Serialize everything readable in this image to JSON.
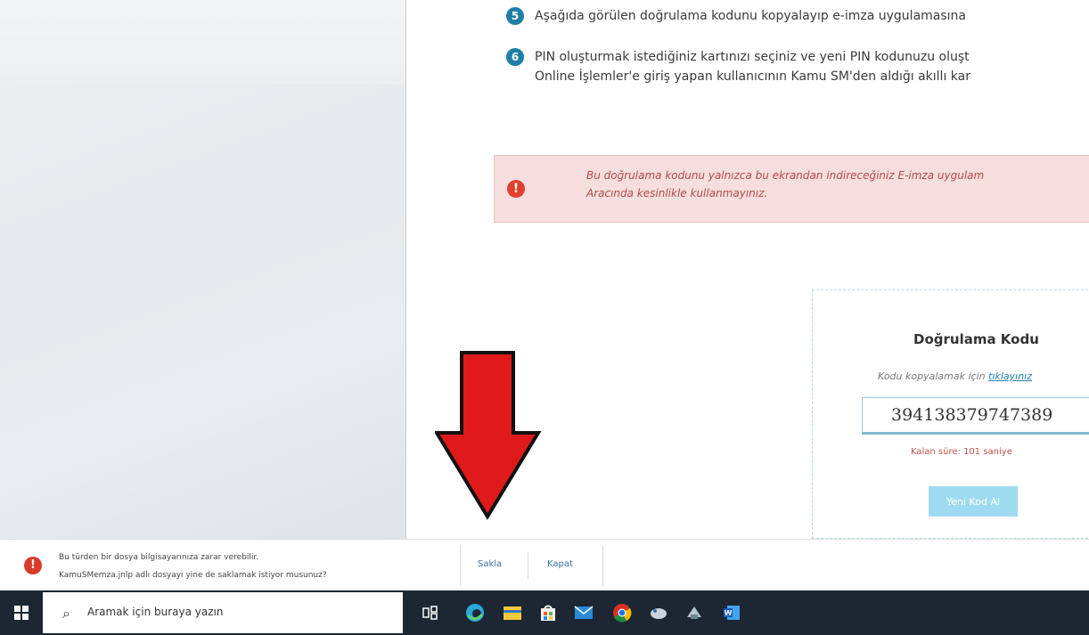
{
  "steps": [
    {
      "num": "5",
      "text": "Aşağıda görülen doğrulama kodunu kopyalayıp e-imza uygulamasına"
    },
    {
      "num": "6",
      "text": "PIN oluşturmak istediğiniz kartınızı seçiniz ve yeni PIN kodunuzu oluşt",
      "text2": "Online İşlemler'e giriş yapan kullanıcının Kamu SM'den aldığı akıllı kar"
    }
  ],
  "alert": {
    "icon": "!",
    "line1": "Bu doğrulama kodunu yalnızca bu ekrandan indireceğiniz E-imza uygulam",
    "line2": "Aracında kesinlikle kullanmayınız."
  },
  "verification": {
    "title": "Doğrulama Kodu",
    "hint": "Kodu kopyalamak için",
    "hint_link": "tıklayınız",
    "code": "394138379747389",
    "timer": "Kalan süre: 101 saniye",
    "button": "Yeni Kod Al"
  },
  "download_bar": {
    "icon": "!",
    "line1": "Bu türden bir dosya bilgisayarınıza zarar verebilir.",
    "line2": "KamuSMemza.jnlp adlı dosyayı yine de saklamak istiyor musunuz?",
    "keep": "Sakla",
    "discard": "Kapat"
  },
  "taskbar": {
    "search_placeholder": "Aramak için buraya yazın",
    "icons": [
      "task-view-icon",
      "edge-icon",
      "file-explorer-icon",
      "store-icon",
      "mail-icon",
      "chrome-icon",
      "app-icon",
      "app-icon-2",
      "word-icon"
    ]
  },
  "colors": {
    "accent": "#1f7fa6",
    "alert_bg": "#f5dedd",
    "arrow": "#e0191a",
    "taskbar": "#1c2733"
  }
}
